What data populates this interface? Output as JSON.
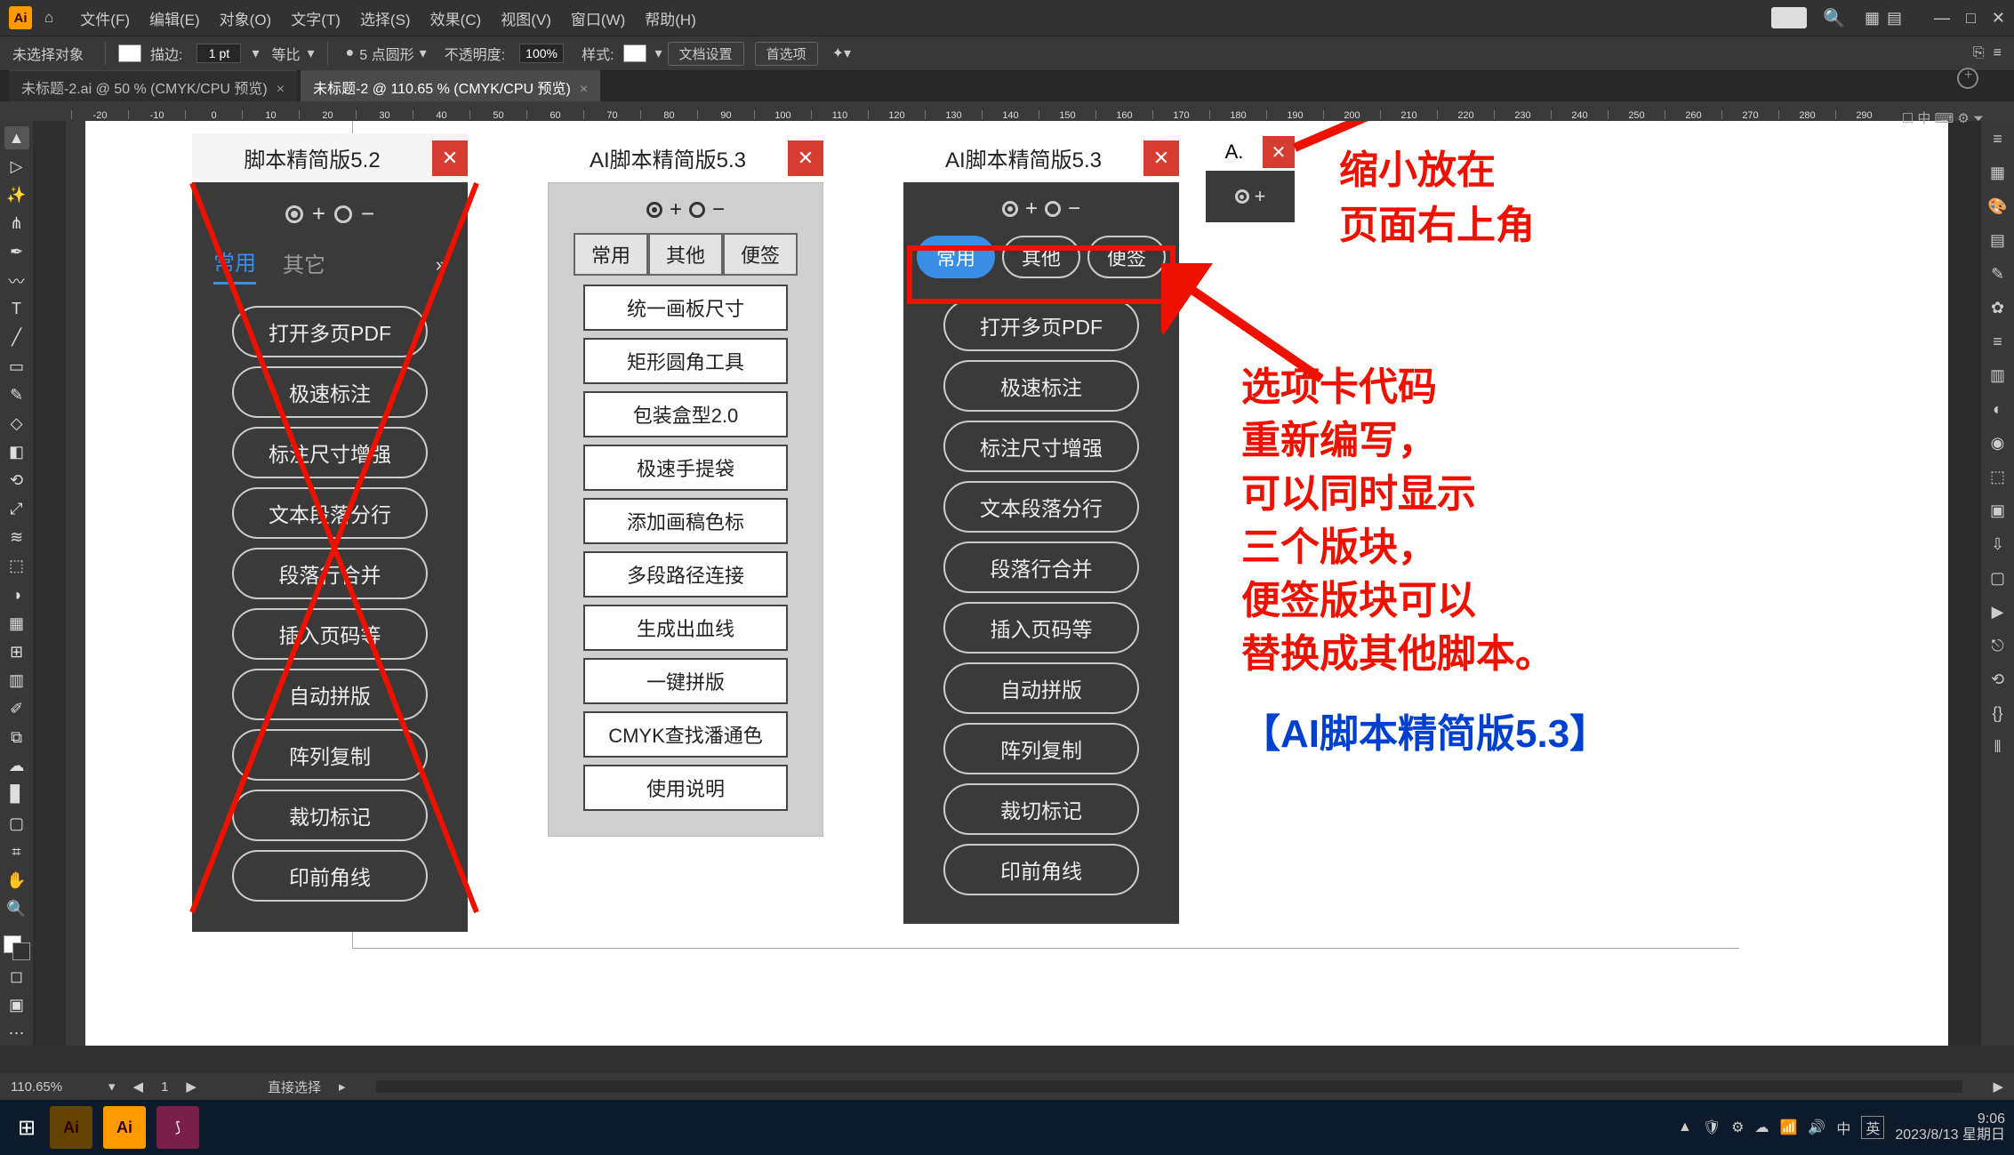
{
  "menubar": {
    "items": [
      "文件(F)",
      "编辑(E)",
      "对象(O)",
      "文字(T)",
      "选择(S)",
      "效果(C)",
      "视图(V)",
      "窗口(W)",
      "帮助(H)"
    ]
  },
  "optbar": {
    "noSelection": "未选择对象",
    "strokeLabel": "描边:",
    "strokeVal": "1 pt",
    "uniformLabel": "等比",
    "roundLabel": "5 点圆形",
    "opacityLabel": "不透明度:",
    "opacityVal": "100%",
    "styleLabel": "样式:",
    "docSetup": "文档设置",
    "prefs": "首选项"
  },
  "tabs": {
    "t1": "未标题-2.ai @ 50 % (CMYK/CPU 预览)",
    "t2": "未标题-2 @ 110.65 % (CMYK/CPU 预览)"
  },
  "ruler": [
    "-20",
    "-10",
    "0",
    "10",
    "20",
    "30",
    "40",
    "50",
    "60",
    "70",
    "80",
    "90",
    "100",
    "110",
    "120",
    "130",
    "140",
    "150",
    "160",
    "170",
    "180",
    "190",
    "200",
    "210",
    "220",
    "230",
    "240",
    "250",
    "260",
    "270",
    "280",
    "290"
  ],
  "panel52": {
    "title": "脚本精简版5.2",
    "tabs": [
      "常用",
      "其它"
    ],
    "buttons": [
      "打开多页PDF",
      "极速标注",
      "标注尺寸增强",
      "文本段落分行",
      "段落行合并",
      "插入页码等",
      "自动拼版",
      "阵列复制",
      "裁切标记",
      "印前角线"
    ]
  },
  "panel53l": {
    "title": "AI脚本精简版5.3",
    "tabs": [
      "常用",
      "其他",
      "便签"
    ],
    "buttons": [
      "统一画板尺寸",
      "矩形圆角工具",
      "包装盒型2.0",
      "极速手提袋",
      "添加画稿色标",
      "多段路径连接",
      "生成出血线",
      "一键拼版",
      "CMYK查找潘通色",
      "使用说明"
    ]
  },
  "panel53d": {
    "title": "AI脚本精简版5.3",
    "tabs": [
      "常用",
      "其他",
      "便签"
    ],
    "buttons": [
      "打开多页PDF",
      "极速标注",
      "标注尺寸增强",
      "文本段落分行",
      "段落行合并",
      "插入页码等",
      "自动拼版",
      "阵列复制",
      "裁切标记",
      "印前角线"
    ]
  },
  "panelMini": {
    "title": "A."
  },
  "anno": {
    "top1": "缩小放在",
    "top2": "页面右上角",
    "mid1": "选项卡代码",
    "mid2": "重新编写，",
    "mid3": "可以同时显示",
    "mid4": "三个版块，",
    "mid5": "便签版块可以",
    "mid6": "替换成其他脚本。",
    "bottom": "【AI脚本精简版5.3】"
  },
  "status": {
    "zoom": "110.65%",
    "toolLabel": "直接选择"
  },
  "taskbar": {
    "time": "9:06",
    "date": "2023/8/13 星期日"
  },
  "miniRight": {
    "label": "A."
  }
}
